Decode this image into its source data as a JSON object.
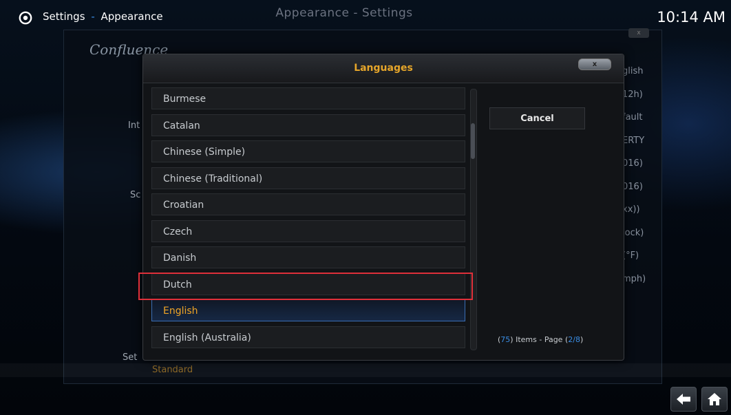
{
  "header": {
    "section": "Settings",
    "separator": "-",
    "subsection": "Appearance",
    "clock": "10:14 AM"
  },
  "background_window": {
    "title": "Appearance - Settings",
    "close_label": "x",
    "logo_text": "Confluence",
    "left_labels": [
      "Int",
      "Sc",
      "Set"
    ],
    "skin_value": "Standard",
    "right_values": [
      "glish",
      "12h)",
      "fault",
      "ERTY",
      "016)",
      "016)",
      "xx))",
      "lock)",
      "(°F)",
      "mph)"
    ]
  },
  "dialog": {
    "title": "Languages",
    "close_label": "x",
    "items": [
      {
        "label": "Burmese"
      },
      {
        "label": "Catalan"
      },
      {
        "label": "Chinese (Simple)"
      },
      {
        "label": "Chinese (Traditional)"
      },
      {
        "label": "Croatian"
      },
      {
        "label": "Czech"
      },
      {
        "label": "Danish"
      },
      {
        "label": "Dutch"
      },
      {
        "label": "English"
      },
      {
        "label": "English (Australia)"
      }
    ],
    "selected_index": 8,
    "highlighted_item": "Dutch",
    "cancel_label": "Cancel",
    "footer": {
      "open_paren": "(",
      "item_count": "75",
      "items_text": ") Items - Page (",
      "page": "2/8",
      "close_paren": ")"
    }
  },
  "colors": {
    "accent_blue": "#3a8ee6",
    "selection_orange": "#f0a526",
    "highlight_red": "#e0303a"
  },
  "icons": [
    "gear-icon",
    "back-arrow-icon",
    "home-icon"
  ]
}
